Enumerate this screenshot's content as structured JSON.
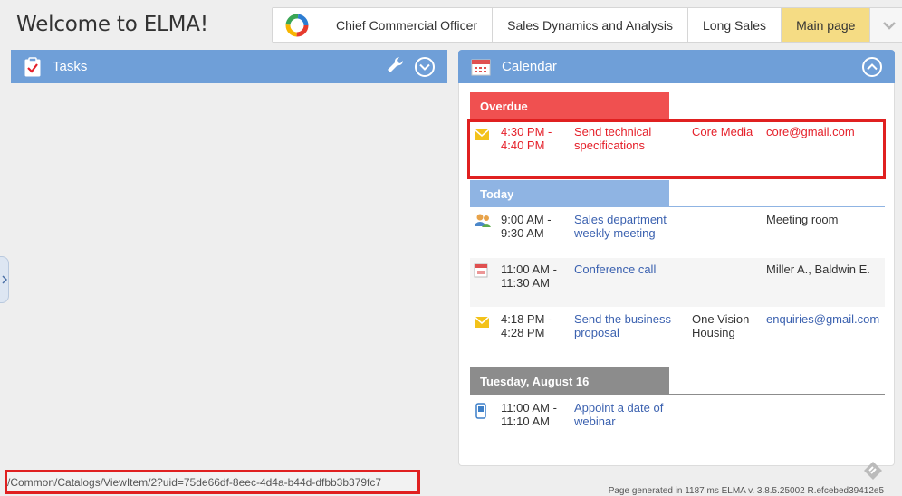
{
  "header": {
    "title": "Welcome to ELMA!"
  },
  "nav": {
    "tabs": [
      {
        "label": "Chief Commercial Officer",
        "active": false
      },
      {
        "label": "Sales Dynamics and Analysis",
        "active": false
      },
      {
        "label": "Long Sales",
        "active": false
      },
      {
        "label": "Main page",
        "active": true
      }
    ]
  },
  "tasks": {
    "title": "Tasks"
  },
  "calendar": {
    "title": "Calendar",
    "sections": {
      "overdue": "Overdue",
      "today": "Today",
      "upcoming": "Tuesday, August 16"
    },
    "events": [
      {
        "time": "4:30 PM - 4:40 PM",
        "title": "Send technical specifications",
        "org": "Core Media",
        "extra": "core@gmail.com",
        "icon": "envelope-icon"
      },
      {
        "time": "9:00 AM - 9:30 AM",
        "title": "Sales department weekly meeting",
        "org": "",
        "extra": "Meeting room",
        "icon": "people-icon"
      },
      {
        "time": "11:00 AM - 11:30 AM",
        "title": "Conference call",
        "org": "",
        "extra": "Miller A., Baldwin E.",
        "icon": "calendar-icon"
      },
      {
        "time": "4:18 PM - 4:28 PM",
        "title": "Send the business proposal",
        "org": "One Vision Housing",
        "extra": "enquiries@gmail.com",
        "icon": "envelope-icon"
      },
      {
        "time": "11:00 AM - 11:10 AM",
        "title": "Appoint a date of webinar",
        "org": "",
        "extra": "",
        "icon": "phone-icon"
      }
    ]
  },
  "status": {
    "url": "/Common/Catalogs/ViewItem/2?uid=75de66df-8eec-4d4a-b44d-dfbb3b379fc7",
    "footer": "Page generated in 1187 ms ELMA v. 3.8.5.25002 R.efcebed39412e5"
  },
  "colors": {
    "accent": "#6f9fd8",
    "overdue": "#f05050",
    "today": "#8fb4e3",
    "upcoming": "#8c8c8c",
    "active_tab": "#f5dc84"
  }
}
